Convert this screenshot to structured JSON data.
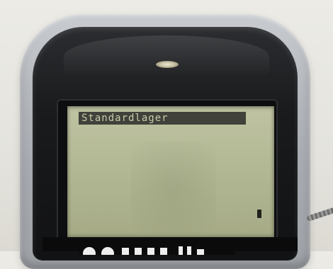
{
  "lcd": {
    "title": "Standardlager"
  },
  "colors": {
    "lcd_background": "#b4b996",
    "lcd_highlight": "#3f413a",
    "shell": "#b5b8bd",
    "bezel": "#1a1b1d"
  }
}
